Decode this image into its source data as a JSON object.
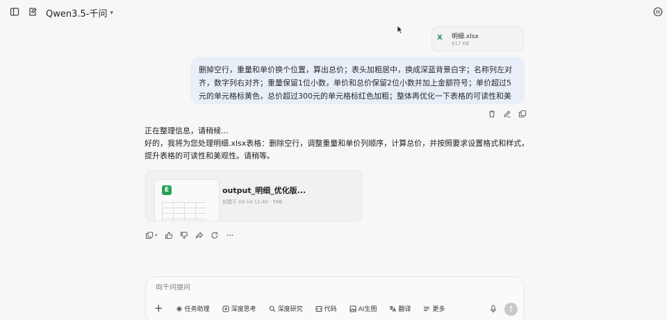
{
  "header": {
    "model_label": "Qwen3.5-千问",
    "icons": [
      "sidebar-toggle-icon",
      "new-chat-icon",
      "chevron-down-icon",
      "pause-icon"
    ]
  },
  "attachment": {
    "file_name": "明细.xlsx",
    "file_size": "617 KB"
  },
  "user_message": {
    "text": "删掉空行，重量和单价换个位置，算出总价；表头加粗居中，换成深蓝背景白字；名称列左对齐，数字列右对齐；重量保留1位小数，单价和总价保留2位小数并加上金额符号；单价超过5元的单元格标黄色，总价超过300元的单元格标红色加粗；整体再优化一下表格的可读性和美观感"
  },
  "assistant": {
    "status_line": "正在整理信息，请稍候...",
    "reply": "好的，我将为您处理明细.xlsx表格：删除空行，调整重量和单价列顺序，计算总价，并按照要求设置格式和样式，提升表格的可读性和美观性。请稍等。",
    "output_file": {
      "badge": "E",
      "name": "output_明细_优化版...",
      "meta": "创建于 04-14 11:40 · 5KB"
    }
  },
  "composer": {
    "placeholder": "向千问提问",
    "tools": [
      {
        "icon": "task-assistant-icon",
        "label": "任务助理"
      },
      {
        "icon": "deep-think-icon",
        "label": "深度思考"
      },
      {
        "icon": "deep-research-icon",
        "label": "深度研究"
      },
      {
        "icon": "code-icon",
        "label": "代码"
      },
      {
        "icon": "ai-image-icon",
        "label": "AI生图"
      },
      {
        "icon": "translate-icon",
        "label": "翻译"
      },
      {
        "icon": "more-icon",
        "label": "更多"
      }
    ],
    "plus_label": "+",
    "send_label": "↑"
  },
  "colors": {
    "user_bubble": "#e8eff8",
    "excel_green": "#2aa15b",
    "background": "#f7f7f7"
  }
}
